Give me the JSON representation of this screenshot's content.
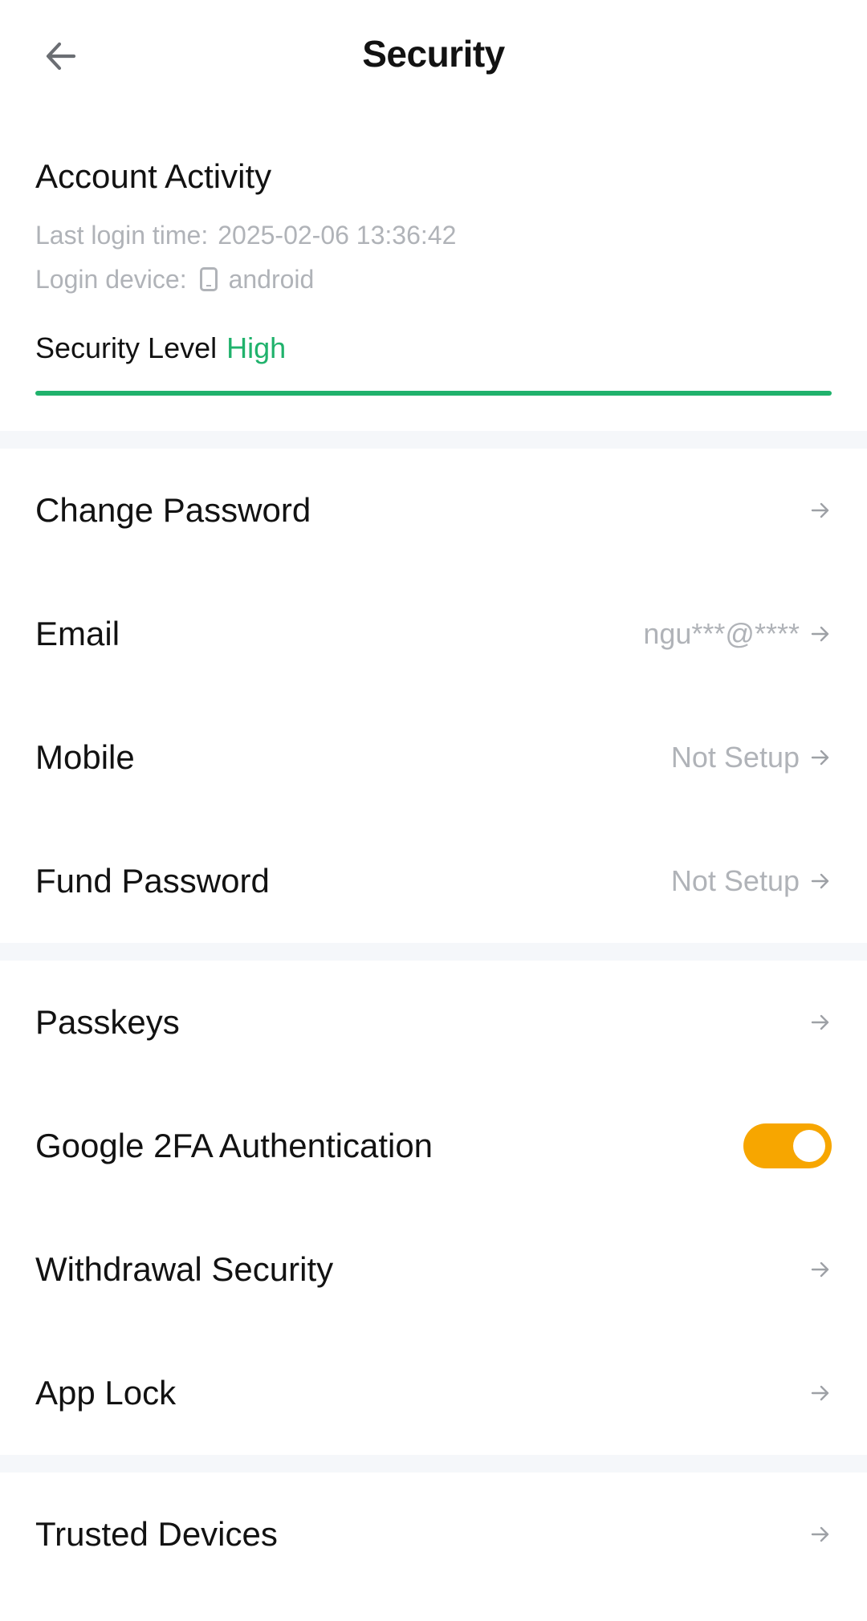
{
  "header": {
    "title": "Security",
    "back_icon": "arrow-left-icon"
  },
  "activity": {
    "title": "Account Activity",
    "last_login_label": "Last login time:",
    "last_login_value": "2025-02-06 13:36:42",
    "device_label": "Login device:",
    "device_icon": "phone-icon",
    "device_value": "android",
    "security_level_label": "Security Level",
    "security_level_value": "High",
    "security_level_fraction": 1.0
  },
  "group1": [
    {
      "label": "Change Password",
      "value": ""
    },
    {
      "label": "Email",
      "value": "ngu***@****"
    },
    {
      "label": "Mobile",
      "value": "Not Setup"
    },
    {
      "label": "Fund Password",
      "value": "Not Setup"
    }
  ],
  "group2": [
    {
      "label": "Passkeys",
      "value": ""
    },
    {
      "label": "Google 2FA Authentication",
      "toggle": true
    },
    {
      "label": "Withdrawal Security",
      "value": ""
    },
    {
      "label": "App Lock",
      "value": ""
    }
  ],
  "group3": [
    {
      "label": "Trusted Devices",
      "value": ""
    }
  ],
  "colors": {
    "accent_green": "#20b26c",
    "toggle_on": "#f7a600",
    "muted_text": "#b0b3b8",
    "separator": "#f5f7fa"
  }
}
